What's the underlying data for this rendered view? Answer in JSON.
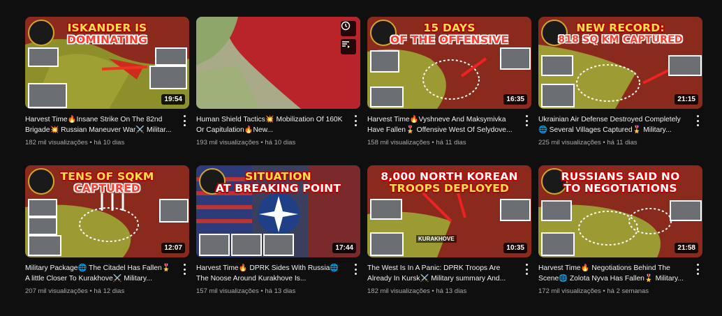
{
  "videos": [
    {
      "overlay_line1": "ISKANDER IS",
      "overlay_line2": "DOMINATING",
      "duration": "19:54",
      "title": "Harvest Time🔥Insane Strike On The 82nd Brigade💥 Russian Maneuver War⚔️ Militar...",
      "views": "182 mil visualizações",
      "age": "há 10 dias"
    },
    {
      "overlay_line1": "",
      "overlay_line2": "",
      "duration": "",
      "hover_icons": [
        "clock-icon",
        "add-queue-icon"
      ],
      "title": "Human Shield Tactics💥 Mobilization Of 160K Or Capitulation🔥New...",
      "views": "193 mil visualizações",
      "age": "há 10 dias"
    },
    {
      "overlay_line1": "15 DAYS",
      "overlay_line2": "OF THE OFFENSIVE",
      "duration": "16:35",
      "title": "Harvest Time🔥Vyshneve And Maksymivka Have Fallen🎖️ Offensive West Of Selydove...",
      "views": "158 mil visualizações",
      "age": "há 11 dias"
    },
    {
      "overlay_line1": "NEW RECORD:",
      "overlay_line2": "818 SQ KM CAPTURED",
      "duration": "21:15",
      "title": "Ukrainian Air Defense Destroyed Completely🌐 Several Villages Captured🎖️ Military...",
      "views": "225 mil visualizações",
      "age": "há 11 dias"
    },
    {
      "overlay_line1": "TENS OF SQKM",
      "overlay_line2": "CAPTURED",
      "duration": "12:07",
      "title": "Military Package🌐 The Citadel Has Fallen🎖️ A little Closer To Kurakhove⚔️ Military...",
      "views": "207 mil visualizações",
      "age": "há 12 dias"
    },
    {
      "overlay_line1": "SITUATION",
      "overlay_line2": "AT BREAKING POINT",
      "duration": "17:44",
      "title": "Harvest Time🔥 DPRK Sides With Russia🌐 The Noose Around Kurakhove Is...",
      "views": "157 mil visualizações",
      "age": "há 13 dias"
    },
    {
      "overlay_line1": "8,000 NORTH KOREAN",
      "overlay_line2": "TROOPS DEPLOYED",
      "duration": "10:35",
      "town": "KURAKHOVE",
      "title": "The West Is In A Panic: DPRK Troops Are Already In Kursk⚔️ Military summary And...",
      "views": "182 mil visualizações",
      "age": "há 13 dias"
    },
    {
      "overlay_line1": "RUSSIANS SAID NO",
      "overlay_line2": "TO NEGOTIATIONS",
      "duration": "21:58",
      "title": "Harvest Time🔥 Negotiations Behind The Scene🌐 Zolota Nyva Has Fallen🎖️ Military...",
      "views": "172 mil visualizações",
      "age": "há 2 semanas"
    }
  ],
  "separator": "•",
  "colors": {
    "background": "#0f0f0f",
    "title": "#f1f1f1",
    "meta": "#aaaaaa",
    "overlay_red": "#ff3b30",
    "overlay_yellow": "#ffe14a"
  }
}
